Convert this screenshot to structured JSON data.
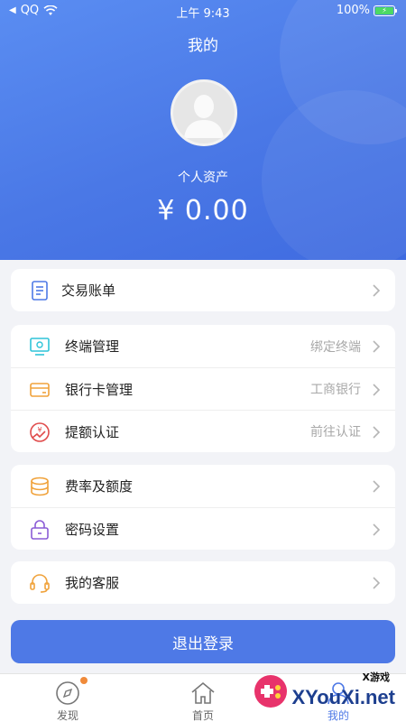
{
  "status_bar": {
    "carrier": "QQ",
    "time": "上午 9:43",
    "battery": "100%"
  },
  "header": {
    "title": "我的",
    "asset_label": "个人资产",
    "asset_value": "¥ 0.00"
  },
  "menu": {
    "bill": {
      "label": "交易账单",
      "icon": "document-icon"
    },
    "terminal": {
      "label": "终端管理",
      "value": "绑定终端",
      "icon": "monitor-icon"
    },
    "bank_card": {
      "label": "银行卡管理",
      "value": "工商银行",
      "icon": "card-icon"
    },
    "limit": {
      "label": "提额认证",
      "value": "前往认证",
      "icon": "yen-arrow-icon"
    },
    "rate": {
      "label": "费率及额度",
      "icon": "coins-icon"
    },
    "password": {
      "label": "密码设置",
      "icon": "lock-icon"
    },
    "service": {
      "label": "我的客服",
      "icon": "headset-icon"
    }
  },
  "logout_label": "退出登录",
  "tabbar": {
    "discover": "发现",
    "home": "首页",
    "mine": "我的"
  },
  "watermark": {
    "small": "X游戏",
    "big": "XYouXi.net"
  },
  "colors": {
    "accent": "#4e79e6",
    "header_gradient_start": "#5a8df2",
    "header_gradient_end": "#3f6be0",
    "badge": "#f08a3a"
  }
}
